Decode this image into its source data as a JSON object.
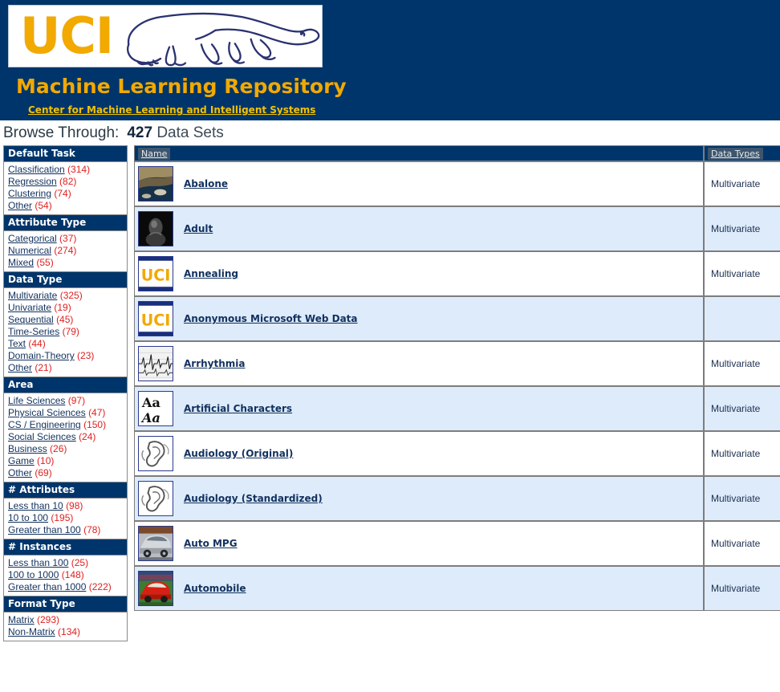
{
  "masthead": {
    "logo_text": "UCI",
    "logo_icon": "anteater-icon",
    "title": "Machine Learning Repository",
    "subtitle_link": "Center for Machine Learning and Intelligent Systems",
    "navy": "#00356B",
    "gold": "#F2A900"
  },
  "browse": {
    "label": "Browse Through:",
    "count": "427",
    "count_suffix": "Data Sets"
  },
  "sidebar": {
    "facets": [
      {
        "title": "Default Task",
        "items": [
          {
            "label": "Classification",
            "count": "(314)"
          },
          {
            "label": "Regression",
            "count": "(82)"
          },
          {
            "label": "Clustering",
            "count": "(74)"
          },
          {
            "label": "Other",
            "count": "(54)"
          }
        ]
      },
      {
        "title": "Attribute Type",
        "items": [
          {
            "label": "Categorical",
            "count": "(37)"
          },
          {
            "label": "Numerical",
            "count": "(274)"
          },
          {
            "label": "Mixed",
            "count": "(55)"
          }
        ]
      },
      {
        "title": "Data Type",
        "items": [
          {
            "label": "Multivariate",
            "count": "(325)"
          },
          {
            "label": "Univariate",
            "count": "(19)"
          },
          {
            "label": "Sequential",
            "count": "(45)"
          },
          {
            "label": "Time-Series",
            "count": "(79)"
          },
          {
            "label": "Text",
            "count": "(44)"
          },
          {
            "label": "Domain-Theory",
            "count": "(23)"
          },
          {
            "label": "Other",
            "count": "(21)"
          }
        ]
      },
      {
        "title": "Area",
        "items": [
          {
            "label": "Life Sciences",
            "count": "(97)"
          },
          {
            "label": "Physical Sciences",
            "count": "(47)"
          },
          {
            "label": "CS / Engineering",
            "count": "(150)"
          },
          {
            "label": "Social Sciences",
            "count": "(24)"
          },
          {
            "label": "Business",
            "count": "(26)"
          },
          {
            "label": "Game",
            "count": "(10)"
          },
          {
            "label": "Other",
            "count": "(69)"
          }
        ]
      },
      {
        "title": "# Attributes",
        "items": [
          {
            "label": "Less than 10",
            "count": "(98)"
          },
          {
            "label": "10 to 100",
            "count": "(195)"
          },
          {
            "label": "Greater than 100",
            "count": "(78)"
          }
        ]
      },
      {
        "title": "# Instances",
        "items": [
          {
            "label": "Less than 100",
            "count": "(25)"
          },
          {
            "label": "100 to 1000",
            "count": "(148)"
          },
          {
            "label": "Greater than 1000",
            "count": "(222)"
          }
        ]
      },
      {
        "title": "Format Type",
        "items": [
          {
            "label": "Matrix",
            "count": "(293)"
          },
          {
            "label": "Non-Matrix",
            "count": "(134)"
          }
        ]
      }
    ]
  },
  "table": {
    "columns": [
      {
        "label": "Name",
        "key": "name"
      },
      {
        "label": "Data Types",
        "key": "data_types"
      }
    ],
    "rows": [
      {
        "name": "Abalone",
        "data_types": "Multivariate",
        "thumb": "abalone-thumb"
      },
      {
        "name": "Adult",
        "data_types": "Multivariate",
        "thumb": "adult-thumb"
      },
      {
        "name": "Annealing",
        "data_types": "Multivariate",
        "thumb": "uci-logo-thumb"
      },
      {
        "name": "Anonymous Microsoft Web Data",
        "data_types": "",
        "thumb": "uci-logo-thumb"
      },
      {
        "name": "Arrhythmia",
        "data_types": "Multivariate",
        "thumb": "ecg-thumb"
      },
      {
        "name": "Artificial Characters",
        "data_types": "Multivariate",
        "thumb": "letters-thumb"
      },
      {
        "name": "Audiology (Original)",
        "data_types": "Multivariate",
        "thumb": "ear-thumb"
      },
      {
        "name": "Audiology (Standardized)",
        "data_types": "Multivariate",
        "thumb": "ear-thumb"
      },
      {
        "name": "Auto MPG",
        "data_types": "Multivariate",
        "thumb": "car-thumb"
      },
      {
        "name": "Automobile",
        "data_types": "Multivariate",
        "thumb": "red-car-thumb"
      }
    ]
  }
}
